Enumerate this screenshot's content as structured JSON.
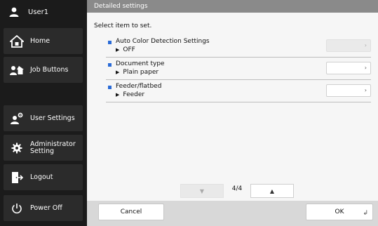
{
  "user": {
    "name": "User1"
  },
  "sidebar": {
    "items": [
      {
        "label": "Home",
        "icon": "home-icon"
      },
      {
        "label": "Job Buttons",
        "icon": "job-buttons-icon"
      },
      {
        "label": "User Settings",
        "icon": "user-settings-icon"
      },
      {
        "label_line1": "Administrator",
        "label_line2": "Setting",
        "icon": "gear-icon"
      },
      {
        "label": "Logout",
        "icon": "logout-icon"
      },
      {
        "label": "Power Off",
        "icon": "power-icon"
      }
    ]
  },
  "header": {
    "title": "Detailed settings"
  },
  "main": {
    "instruction": "Select item to set.",
    "items": [
      {
        "name": "Auto Color Detection Settings",
        "value": "OFF",
        "enabled": false
      },
      {
        "name": "Document type",
        "value": "Plain paper",
        "enabled": true
      },
      {
        "name": "Feeder/flatbed",
        "value": "Feeder",
        "enabled": true
      }
    ],
    "pager": {
      "indicator": "4/4",
      "down_enabled": false,
      "up_enabled": true
    }
  },
  "footer": {
    "cancel_label": "Cancel",
    "ok_label": "OK"
  },
  "colors": {
    "accent_bullet": "#2a6bd7",
    "sidebar_bg": "#1b1b1b",
    "header_bg": "#8a8a8a"
  }
}
